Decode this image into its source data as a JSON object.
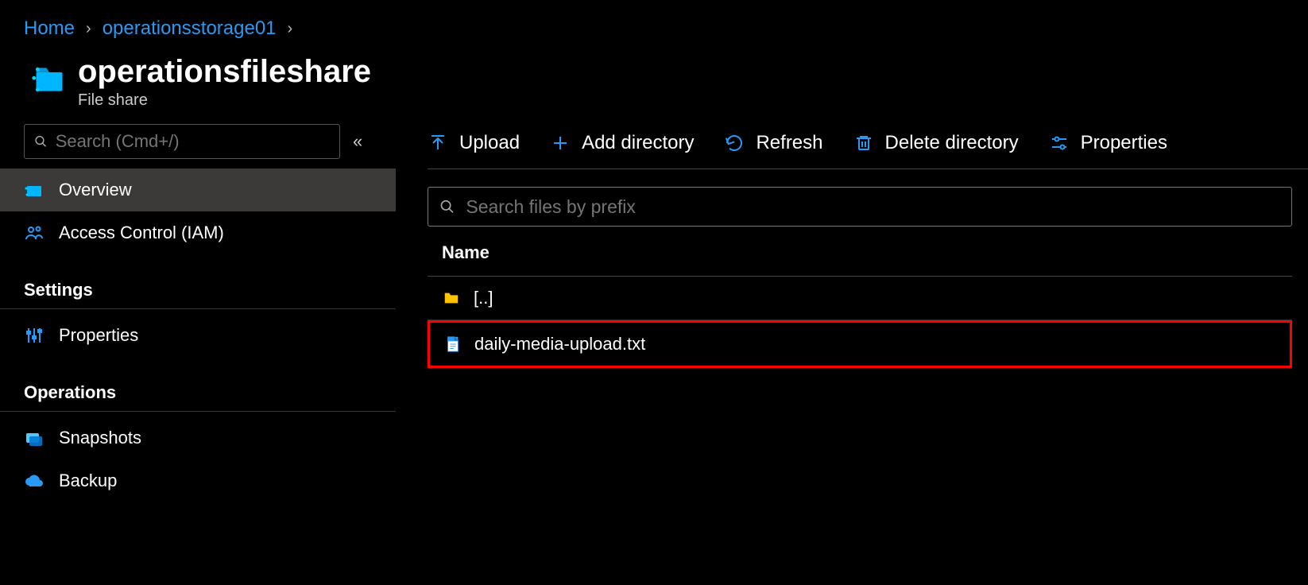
{
  "breadcrumb": {
    "home": "Home",
    "parent": "operationsstorage01"
  },
  "title": "operationsfileshare",
  "subtitle": "File share",
  "sidebar": {
    "searchPlaceholder": "Search (Cmd+/)",
    "nav": {
      "overview": "Overview",
      "iam": "Access Control (IAM)"
    },
    "sections": {
      "settings": "Settings",
      "operations": "Operations"
    },
    "settingsItems": {
      "properties": "Properties"
    },
    "opsItems": {
      "snapshots": "Snapshots",
      "backup": "Backup"
    }
  },
  "toolbar": {
    "upload": "Upload",
    "addDir": "Add directory",
    "refresh": "Refresh",
    "deleteDir": "Delete directory",
    "properties": "Properties"
  },
  "fileSearchPlaceholder": "Search files by prefix",
  "table": {
    "nameHeader": "Name",
    "parentDir": "[..]",
    "file1": "daily-media-upload.txt"
  }
}
